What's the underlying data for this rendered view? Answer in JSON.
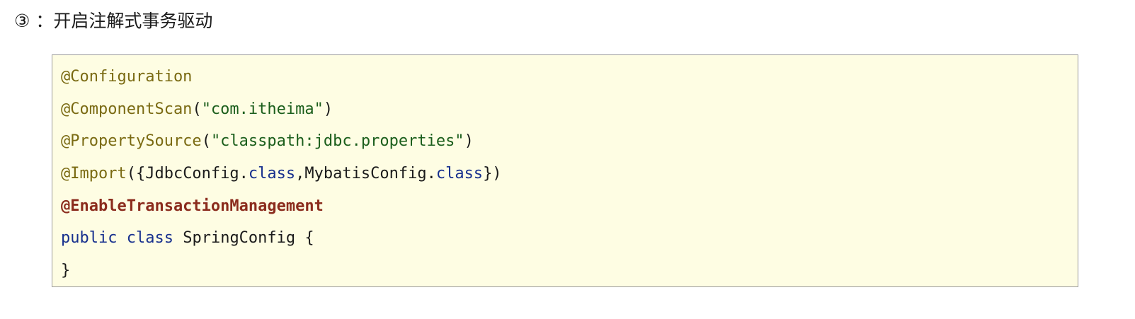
{
  "heading": {
    "text": "③ ：开启注解式事务驱动"
  },
  "code": {
    "lines": [
      [
        {
          "type": "anno",
          "text": "@Configuration"
        }
      ],
      [
        {
          "type": "anno",
          "text": "@ComponentScan"
        },
        {
          "type": "plain",
          "text": "("
        },
        {
          "type": "str",
          "text": "\"com.itheima\""
        },
        {
          "type": "plain",
          "text": ")"
        }
      ],
      [
        {
          "type": "anno",
          "text": "@PropertySource"
        },
        {
          "type": "plain",
          "text": "("
        },
        {
          "type": "str",
          "text": "\"classpath:jdbc.properties\""
        },
        {
          "type": "plain",
          "text": ")"
        }
      ],
      [
        {
          "type": "anno",
          "text": "@Import"
        },
        {
          "type": "plain",
          "text": "({JdbcConfig."
        },
        {
          "type": "kw",
          "text": "class"
        },
        {
          "type": "plain",
          "text": ",MybatisConfig."
        },
        {
          "type": "kw",
          "text": "class"
        },
        {
          "type": "plain",
          "text": "})"
        }
      ],
      [
        {
          "type": "enable",
          "text": "@EnableTransactionManagement"
        }
      ],
      [
        {
          "type": "kw",
          "text": "public"
        },
        {
          "type": "plain",
          "text": " "
        },
        {
          "type": "kw",
          "text": "class"
        },
        {
          "type": "plain",
          "text": " SpringConfig {"
        }
      ],
      [
        {
          "type": "plain",
          "text": "}"
        }
      ]
    ]
  }
}
